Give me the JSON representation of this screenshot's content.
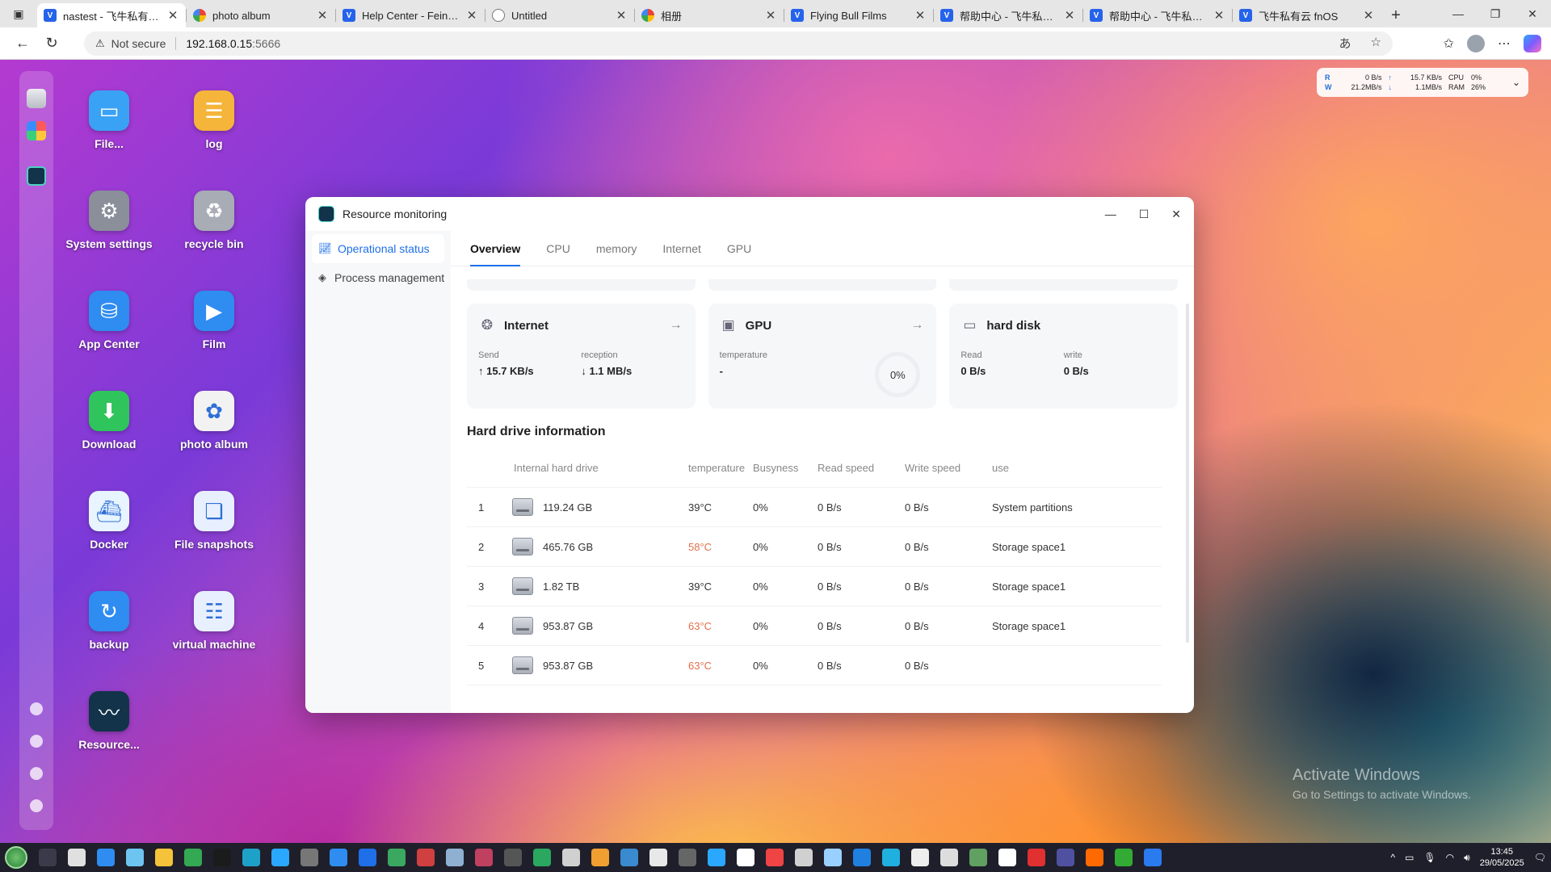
{
  "browser": {
    "tabs": [
      {
        "title": "nastest - 飞牛私有云fnOS",
        "icon": "fn-icon",
        "active": true
      },
      {
        "title": "photo album",
        "icon": "google-icon",
        "active": false
      },
      {
        "title": "Help Center - Feiniu Private Cloud",
        "icon": "fn-icon",
        "active": false
      },
      {
        "title": "Untitled",
        "icon": "globe-icon",
        "active": false
      },
      {
        "title": "相册",
        "icon": "google-icon",
        "active": false
      },
      {
        "title": "Flying Bull Films",
        "icon": "fn-icon",
        "active": false
      },
      {
        "title": "帮助中心 - 飞牛私有云fnOS",
        "icon": "fn-icon",
        "active": false
      },
      {
        "title": "帮助中心 - 飞牛私有云fnOS",
        "icon": "fn-icon",
        "active": false
      },
      {
        "title": "飞牛私有云 fnOS",
        "icon": "fn-icon",
        "active": false
      }
    ],
    "address": {
      "security": "Not secure",
      "host": "192.168.0.15",
      "port": ":5666"
    }
  },
  "desktop": {
    "icons": [
      {
        "label": "File...",
        "icon": "folder-icon",
        "color": "#3aa2f5"
      },
      {
        "label": "log",
        "icon": "log-icon",
        "color": "#f5b43a"
      },
      {
        "label": "System settings",
        "icon": "gear-icon",
        "color": "#8a8f9a"
      },
      {
        "label": "recycle bin",
        "icon": "recycle-icon",
        "color": "#a7acb5"
      },
      {
        "label": "App Center",
        "icon": "store-icon",
        "color": "#2f8cf0"
      },
      {
        "label": "Film",
        "icon": "film-icon",
        "color": "#2f8cf0"
      },
      {
        "label": "Download",
        "icon": "download-icon",
        "color": "#2fc45c"
      },
      {
        "label": "photo album",
        "icon": "photo-icon",
        "color": "#f2f2f2"
      },
      {
        "label": "Docker",
        "icon": "docker-icon",
        "color": "#e8f4ff"
      },
      {
        "label": "File snapshots",
        "icon": "snapshot-icon",
        "color": "#e8f0ff"
      },
      {
        "label": "backup",
        "icon": "backup-icon",
        "color": "#2f8cf0"
      },
      {
        "label": "virtual machine",
        "icon": "vm-icon",
        "color": "#e8f0ff"
      },
      {
        "label": "Resource...",
        "icon": "monitor-icon",
        "color": "#12334a"
      }
    ],
    "sysmon": {
      "r_label": "R",
      "w_label": "W",
      "r_val": "0 B/s",
      "w_val": "21.2MB/s",
      "up_val": "15.7 KB/s",
      "down_val": "1.1MB/s",
      "cpu_label": "CPU",
      "ram_label": "RAM",
      "cpu_val": "0%",
      "ram_val": "26%"
    },
    "watermark": {
      "line1": "Activate Windows",
      "line2": "Go to Settings to activate Windows."
    }
  },
  "window": {
    "title": "Resource monitoring",
    "sidebar": [
      {
        "label": "Operational status",
        "active": true
      },
      {
        "label": "Process management",
        "active": false
      }
    ],
    "tabs": [
      {
        "label": "Overview",
        "active": true
      },
      {
        "label": "CPU",
        "active": false
      },
      {
        "label": "memory",
        "active": false
      },
      {
        "label": "Internet",
        "active": false
      },
      {
        "label": "GPU",
        "active": false
      }
    ],
    "cards": {
      "internet": {
        "title": "Internet",
        "send_label": "Send",
        "send_val": "15.7 KB/s",
        "recv_label": "reception",
        "recv_val": "1.1 MB/s"
      },
      "gpu": {
        "title": "GPU",
        "temp_label": "temperature",
        "temp_val": "-",
        "usage": "0%"
      },
      "disk": {
        "title": "hard disk",
        "read_label": "Read",
        "read_val": "0 B/s",
        "write_label": "write",
        "write_val": "0 B/s"
      }
    },
    "hdd": {
      "title": "Hard drive information",
      "headers": {
        "drive": "Internal hard drive",
        "temp": "temperature",
        "busy": "Busyness",
        "read": "Read speed",
        "write": "Write speed",
        "use": "use"
      },
      "rows": [
        {
          "idx": "1",
          "size": "119.24 GB",
          "temp": "39°C",
          "hot": false,
          "busy": "0%",
          "read": "0 B/s",
          "write": "0 B/s",
          "use": "System partitions"
        },
        {
          "idx": "2",
          "size": "465.76 GB",
          "temp": "58°C",
          "hot": true,
          "busy": "0%",
          "read": "0 B/s",
          "write": "0 B/s",
          "use": "Storage space1"
        },
        {
          "idx": "3",
          "size": "1.82 TB",
          "temp": "39°C",
          "hot": false,
          "busy": "0%",
          "read": "0 B/s",
          "write": "0 B/s",
          "use": "Storage space1"
        },
        {
          "idx": "4",
          "size": "953.87 GB",
          "temp": "63°C",
          "hot": true,
          "busy": "0%",
          "read": "0 B/s",
          "write": "0 B/s",
          "use": "Storage space1"
        },
        {
          "idx": "5",
          "size": "953.87 GB",
          "temp": "63°C",
          "hot": true,
          "busy": "0%",
          "read": "0 B/s",
          "write": "0 B/s",
          "use": ""
        }
      ]
    }
  },
  "taskbar": {
    "time": "13:45",
    "date": "29/05/2025"
  },
  "colors": {
    "accent": "#1e6fe8",
    "hot_temp": "#e0704a"
  }
}
